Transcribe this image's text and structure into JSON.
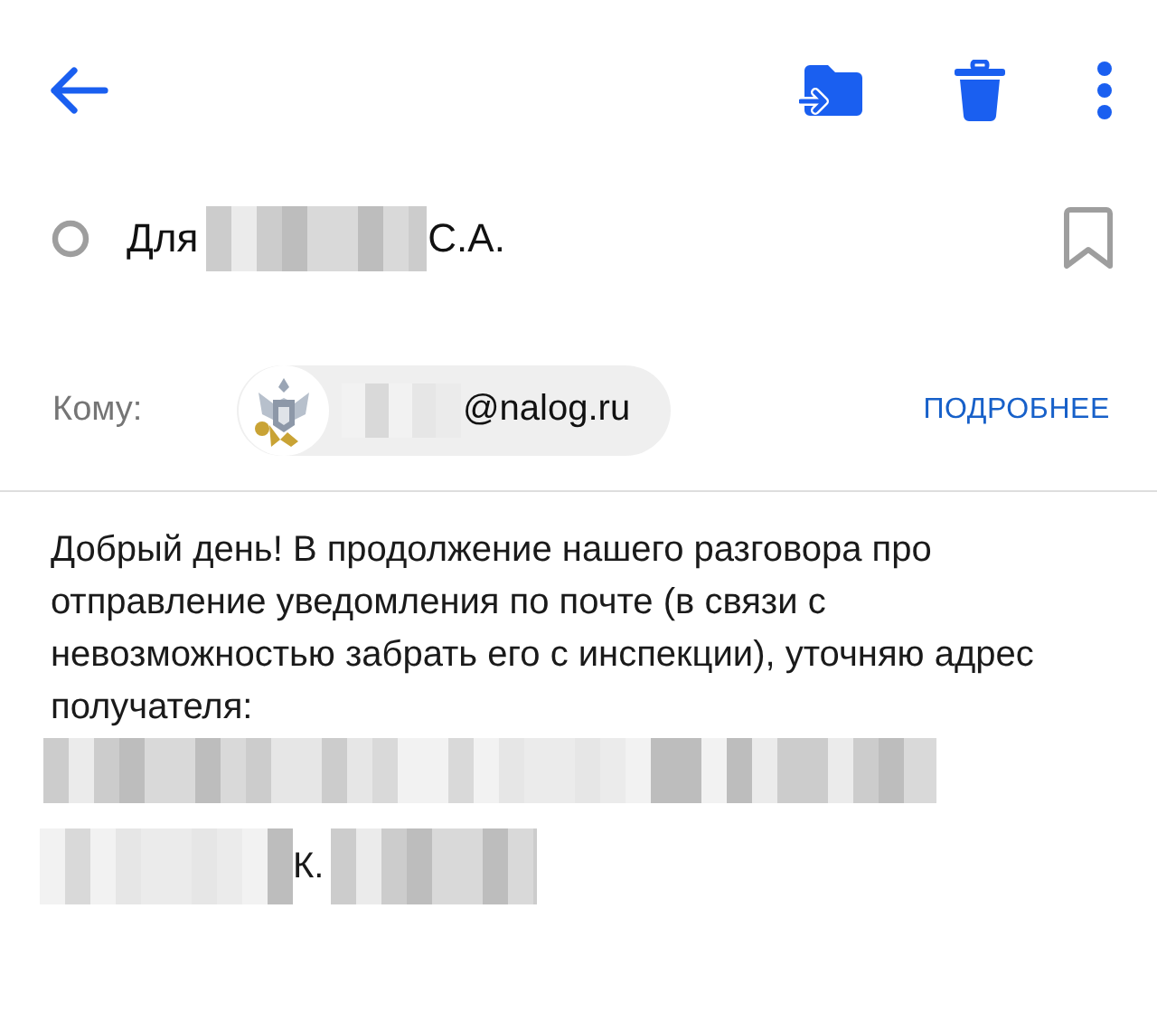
{
  "subject": {
    "prefix": "Для",
    "suffix": "С.А."
  },
  "recipient": {
    "label": "Кому:",
    "address_end": "@nalog.ru",
    "details_link": "ПОДРОБНЕЕ"
  },
  "body": {
    "paragraph": "Добрый день! В продолжение нашего разговора про отправление уведомления по почте (в связи с невозможностью забрать его с инспекции), уточняю адрес получателя:",
    "signature_middle": "К."
  }
}
